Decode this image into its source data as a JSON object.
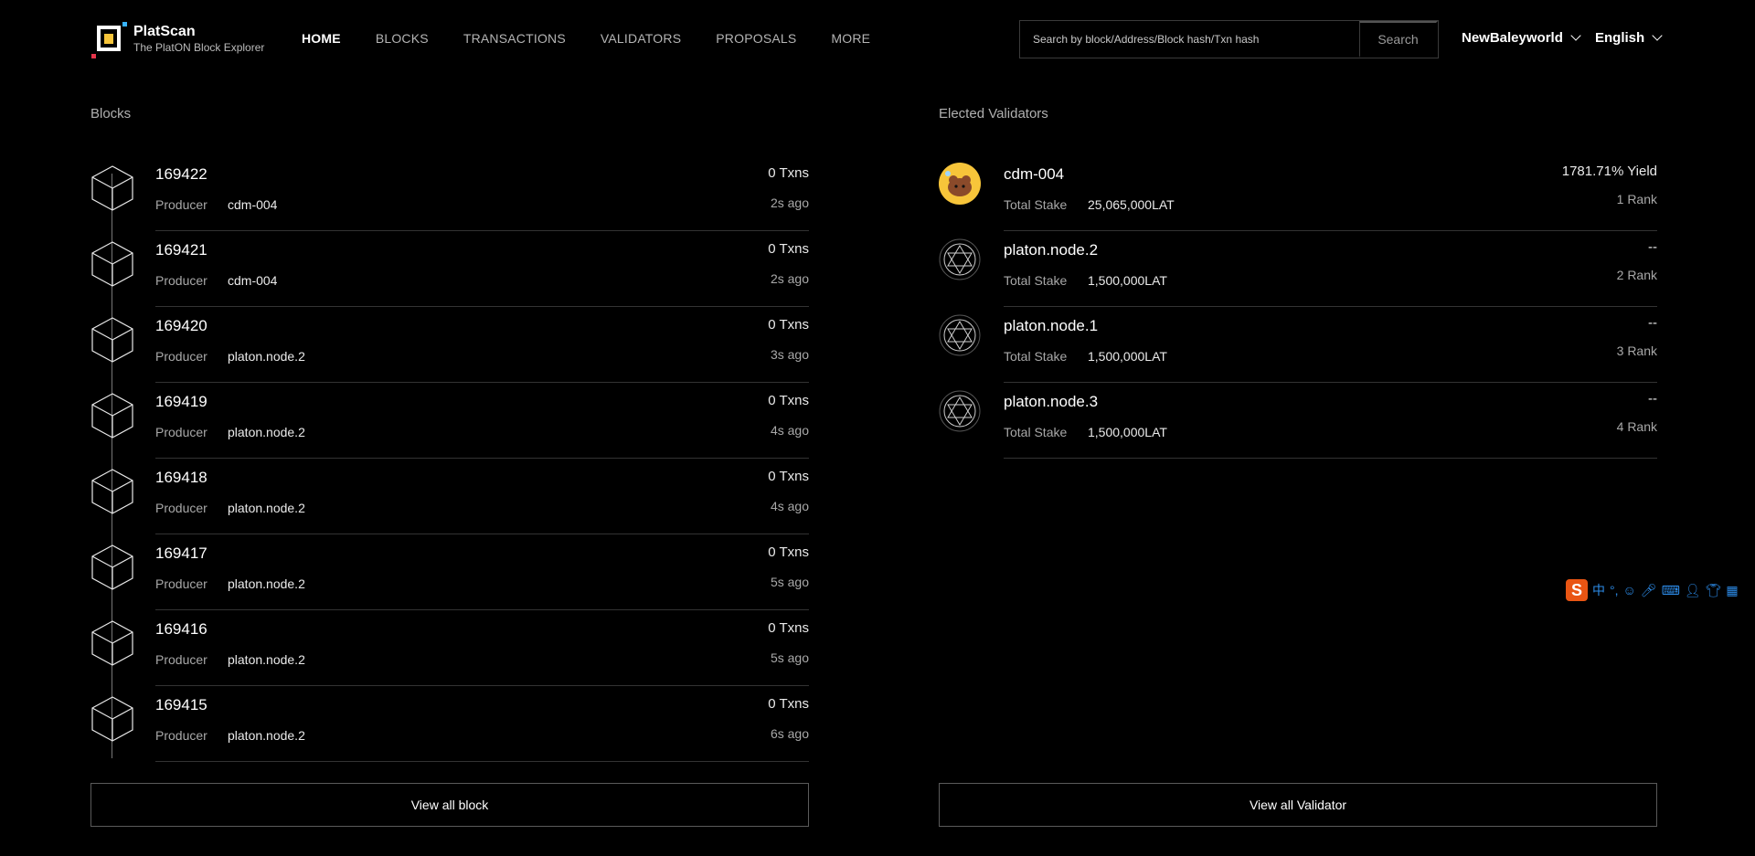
{
  "header": {
    "logo_name": "PlatScan",
    "logo_sub": "The PlatON Block Explorer",
    "nav": [
      {
        "label": "HOME"
      },
      {
        "label": "BLOCKS"
      },
      {
        "label": "TRANSACTIONS"
      },
      {
        "label": "VALIDATORS"
      },
      {
        "label": "PROPOSALS"
      },
      {
        "label": "MORE"
      }
    ],
    "search_placeholder": "Search by block/Address/Block hash/Txn hash",
    "search_button": "Search",
    "network": "NewBaleyworld",
    "language": "English"
  },
  "blocks": {
    "title": "Blocks",
    "producer_label": "Producer",
    "items": [
      {
        "number": "169422",
        "producer": "cdm-004",
        "txns": "0 Txns",
        "ago": "2s  ago"
      },
      {
        "number": "169421",
        "producer": "cdm-004",
        "txns": "0 Txns",
        "ago": "2s  ago"
      },
      {
        "number": "169420",
        "producer": "platon.node.2",
        "txns": "0 Txns",
        "ago": "3s  ago"
      },
      {
        "number": "169419",
        "producer": "platon.node.2",
        "txns": "0 Txns",
        "ago": "4s  ago"
      },
      {
        "number": "169418",
        "producer": "platon.node.2",
        "txns": "0 Txns",
        "ago": "4s  ago"
      },
      {
        "number": "169417",
        "producer": "platon.node.2",
        "txns": "0 Txns",
        "ago": "5s  ago"
      },
      {
        "number": "169416",
        "producer": "platon.node.2",
        "txns": "0 Txns",
        "ago": "5s  ago"
      },
      {
        "number": "169415",
        "producer": "platon.node.2",
        "txns": "0 Txns",
        "ago": "6s  ago"
      }
    ],
    "view_all": "View all block"
  },
  "validators": {
    "title": "Elected Validators",
    "stake_label": "Total Stake",
    "items": [
      {
        "name": "cdm-004",
        "stake": "25,065,000LAT",
        "yield": "1781.71% Yield",
        "rank": "1 Rank",
        "icon": "avatar-image"
      },
      {
        "name": "platon.node.2",
        "stake": "1,500,000LAT",
        "yield": "--",
        "rank": "2 Rank",
        "icon": "platon-logo-icon"
      },
      {
        "name": "platon.node.1",
        "stake": "1,500,000LAT",
        "yield": "--",
        "rank": "3 Rank",
        "icon": "platon-logo-icon"
      },
      {
        "name": "platon.node.3",
        "stake": "1,500,000LAT",
        "yield": "--",
        "rank": "4 Rank",
        "icon": "platon-logo-icon"
      }
    ],
    "view_all": "View all Validator"
  },
  "ime_toolbar": {
    "logo": "S",
    "lang": "中",
    "punct": "°,"
  },
  "colors": {
    "background": "#000000",
    "accent_yellow": "#f7c53a",
    "accent_blue": "#38b4ff",
    "accent_red": "#e8354b"
  }
}
